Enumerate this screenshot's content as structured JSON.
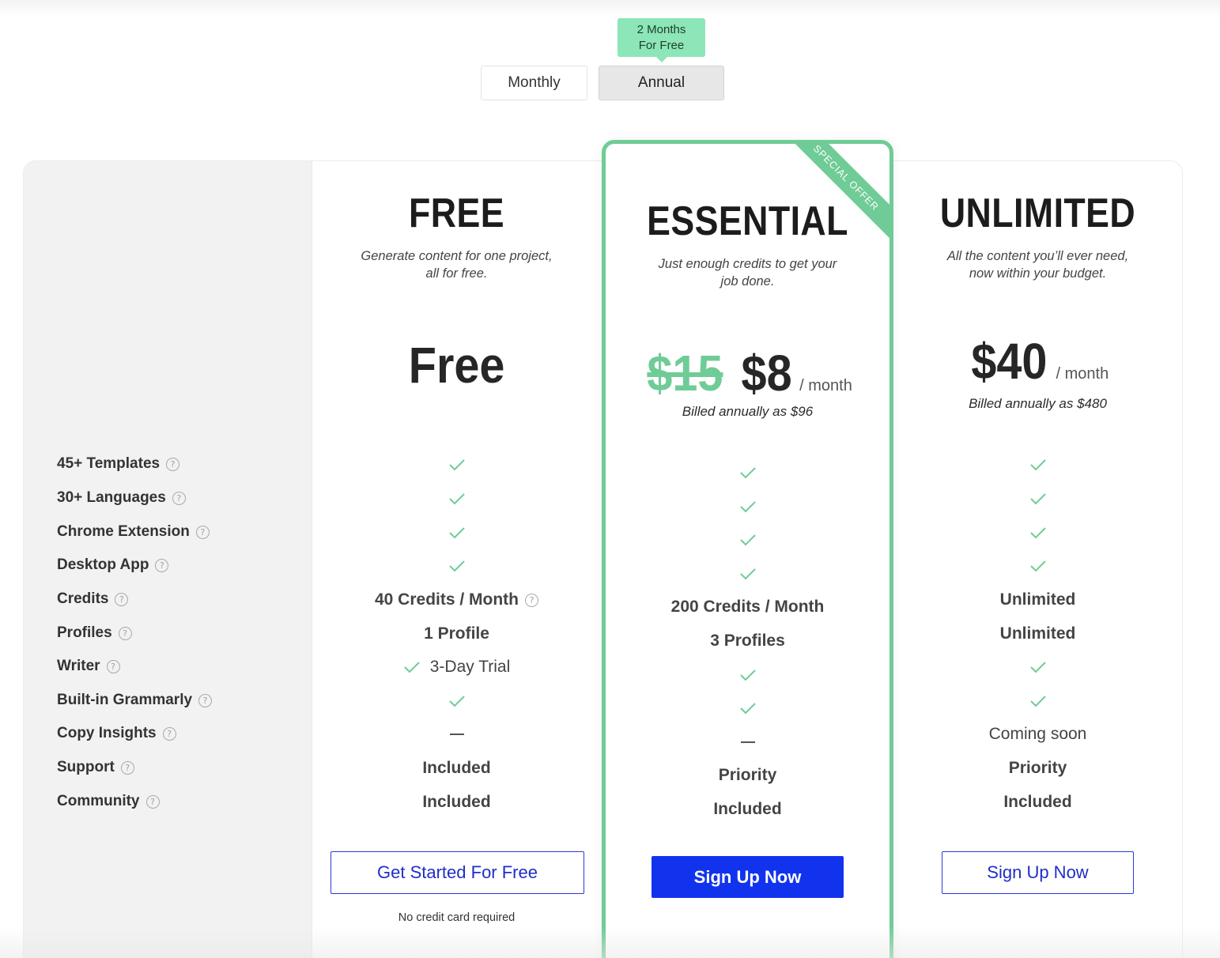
{
  "billing_toggle": {
    "promo_line1": "2 Months",
    "promo_line2": "For Free",
    "monthly_label": "Monthly",
    "annual_label": "Annual",
    "selected": "Annual"
  },
  "features": [
    {
      "label": "45+ Templates"
    },
    {
      "label": "30+ Languages"
    },
    {
      "label": "Chrome Extension"
    },
    {
      "label": "Desktop App"
    },
    {
      "label": "Credits"
    },
    {
      "label": "Profiles"
    },
    {
      "label": "Writer"
    },
    {
      "label": "Built-in Grammarly"
    },
    {
      "label": "Copy Insights"
    },
    {
      "label": "Support"
    },
    {
      "label": "Community"
    }
  ],
  "plans": {
    "free": {
      "name": "FREE",
      "desc_line1": "Generate content for one project,",
      "desc_line2": "all for free.",
      "price": "Free",
      "values": {
        "credits": "40 Credits / Month",
        "profiles": "1 Profile",
        "writer": "3-Day Trial",
        "support": "Included",
        "community": "Included"
      },
      "cta": "Get Started For Free",
      "note": "No credit card required"
    },
    "essential": {
      "ribbon": "SPECIAL OFFER",
      "name": "ESSENTIAL",
      "desc_line1": "Just enough credits to get your",
      "desc_line2": "job done.",
      "old_price": "$15",
      "price": "$8",
      "period": "/  month",
      "billed": "Billed annually as $96",
      "values": {
        "credits": "200 Credits / Month",
        "profiles": "3 Profiles",
        "support": "Priority",
        "community": "Included"
      },
      "cta": "Sign Up Now"
    },
    "unlimited": {
      "name": "UNLIMITED",
      "desc_line1": "All the content you’ll ever need,",
      "desc_line2": "now within your budget.",
      "price": "$40",
      "period": "/  month",
      "billed": "Billed annually as $480",
      "values": {
        "credits": "Unlimited",
        "profiles": "Unlimited",
        "copy_insights": "Coming soon",
        "support": "Priority",
        "community": "Included"
      },
      "cta": "Sign Up Now"
    }
  },
  "icons": {
    "check": "check-icon",
    "help": "help-circle-icon",
    "dash": "dash-icon"
  },
  "colors": {
    "accent_green": "#6fcc96",
    "promo_green": "#8de6b8",
    "cta_blue": "#1233ee"
  }
}
